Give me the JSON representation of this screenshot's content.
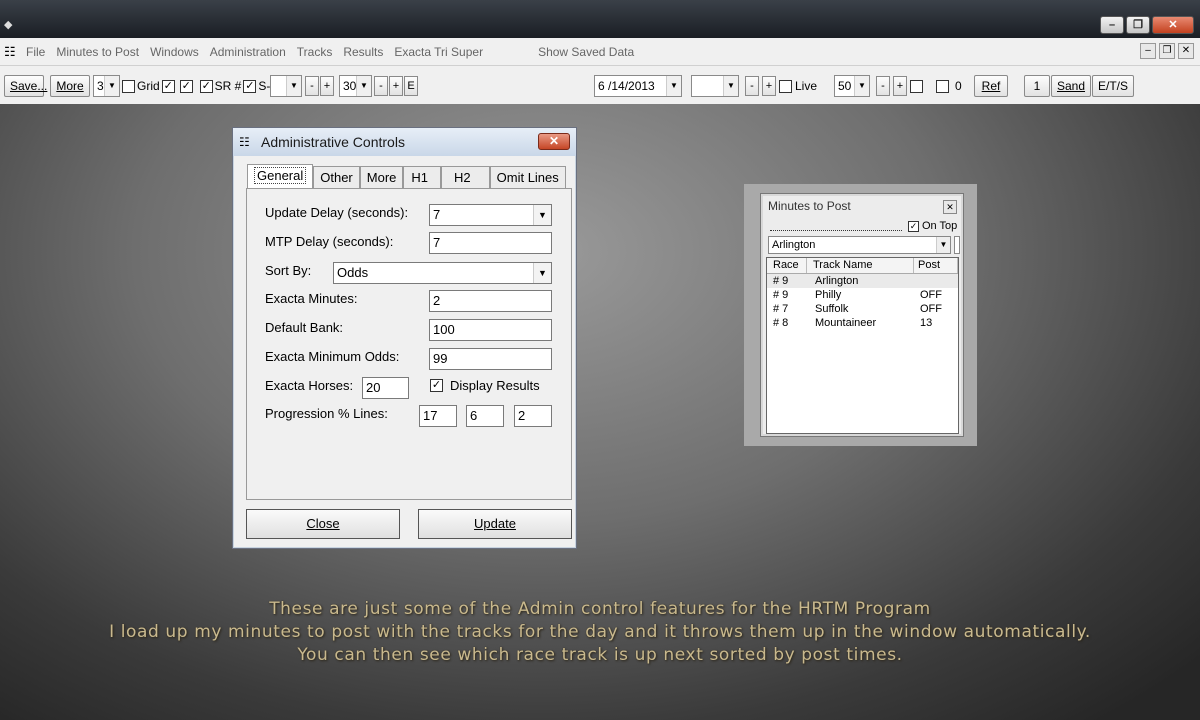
{
  "window": {
    "controls": [
      "minimize",
      "restore",
      "close"
    ]
  },
  "menubar": {
    "items": [
      "File",
      "Minutes to Post",
      "Windows",
      "Administration",
      "Tracks",
      "Results",
      "Exacta Tri Super"
    ],
    "show_saved": "Show Saved Data"
  },
  "toolbar": {
    "save_label": "Save...",
    "more_label": "More",
    "more_value": "3",
    "grid_label": "Grid",
    "sr_label": "SR #",
    "s_label": "S-",
    "blank_combo": "",
    "minus": "-",
    "plus": "+",
    "thirty_value": "30",
    "e_label": "E",
    "date_value": "6 /14/2013",
    "live_label": "Live",
    "fifty_value": "50",
    "zero_label": "0",
    "ref_label": "Ref",
    "one_label": "1",
    "sand_label": "Sand",
    "ets_label": "E/T/S"
  },
  "admin": {
    "title": "Administrative Controls",
    "tabs": [
      "General",
      "Other",
      "More",
      "H1",
      "H2",
      "Omit Lines"
    ],
    "active_tab": "General",
    "fields": {
      "update_delay_label": "Update Delay (seconds):",
      "update_delay_value": "7",
      "mtp_delay_label": "MTP Delay (seconds):",
      "mtp_delay_value": "7",
      "sort_by_label": "Sort By:",
      "sort_by_value": "Odds",
      "exacta_minutes_label": "Exacta Minutes:",
      "exacta_minutes_value": "2",
      "default_bank_label": "Default Bank:",
      "default_bank_value": "100",
      "exacta_min_odds_label": "Exacta Minimum Odds:",
      "exacta_min_odds_value": "99",
      "exacta_horses_label": "Exacta Horses:",
      "exacta_horses_value": "20",
      "display_results_label": "Display Results",
      "progression_label": "Progression % Lines:",
      "progression_values": [
        "17",
        "6",
        "2"
      ]
    },
    "close_label": "Close",
    "update_label": "Update"
  },
  "mtp": {
    "title": "Minutes to Post",
    "ontop_label": "On Top",
    "track_value": "Arlington",
    "columns": [
      "Race",
      "Track Name",
      "Post"
    ],
    "rows": [
      {
        "race": "# 9",
        "track": "Arlington",
        "post": ""
      },
      {
        "race": "# 9",
        "track": "Philly",
        "post": "OFF"
      },
      {
        "race": "# 7",
        "track": "Suffolk",
        "post": "OFF"
      },
      {
        "race": "# 8",
        "track": "Mountaineer",
        "post": "13"
      }
    ]
  },
  "caption": {
    "line1": "These are just some of the Admin control features for the HRTM Program",
    "line2": "I load up my minutes to post with the tracks for the day and it throws them up in the window automatically.",
    "line3": "You can then see which race track is up next sorted by post times."
  },
  "colors": {
    "caption": "#c9b98e",
    "close_red": "#c54626",
    "titlebar_dark": "#1a1e24"
  }
}
